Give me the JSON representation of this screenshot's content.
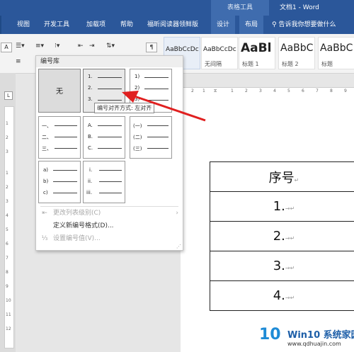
{
  "window": {
    "table_tools_label": "表格工具",
    "doc_title": "文档1  -  Word"
  },
  "tabs": [
    "视图",
    "开发工具",
    "加载项",
    "帮助",
    "福昕阅读器领鲜版",
    "设计",
    "布局"
  ],
  "search": {
    "placeholder": "告诉我你想要做什么",
    "icon": "search-icon"
  },
  "styles": [
    {
      "preview": "AaBbCcDc",
      "name": "正文"
    },
    {
      "preview": "AaBbCcDc",
      "name": "无间隔"
    },
    {
      "preview": "AaBl",
      "name": "标题 1"
    },
    {
      "preview": "AaBbC",
      "name": "标题 2"
    },
    {
      "preview": "AaBbC",
      "name": "标题"
    }
  ],
  "numbering_dropdown": {
    "header": "编号库",
    "none_label": "无",
    "items": [
      {
        "labels": [
          "1.",
          "2.",
          "3."
        ]
      },
      {
        "labels": [
          "1)",
          "2)",
          "3)"
        ]
      },
      {
        "labels": [
          "一、",
          "二、",
          "三、"
        ]
      },
      {
        "labels": [
          "A.",
          "B.",
          "C."
        ]
      },
      {
        "labels": [
          "(一)",
          "(二)",
          "(三)"
        ]
      },
      {
        "labels": [
          "a)",
          "b)",
          "c)"
        ]
      },
      {
        "labels": [
          "i.",
          "ii.",
          "iii."
        ]
      }
    ],
    "tooltip": "编号对齐方式: 左对齐",
    "menu": [
      {
        "label": "更改列表级别(C)",
        "enabled": false,
        "icon": "change-level-icon"
      },
      {
        "label": "定义新编号格式(D)...",
        "enabled": true,
        "icon": ""
      },
      {
        "label": "设置编号值(V)...",
        "enabled": false,
        "icon": "set-value-icon"
      }
    ]
  },
  "document": {
    "rows": [
      "序号",
      "1.",
      "2.",
      "3.",
      "4."
    ]
  },
  "watermark": {
    "logo": "10",
    "title": "Win10 系统家园",
    "url": "www.qdhuajin.com"
  },
  "colors": {
    "title_bar": "#2b579a",
    "context_tab": "#3f6cae",
    "arrow": "#e02020"
  }
}
